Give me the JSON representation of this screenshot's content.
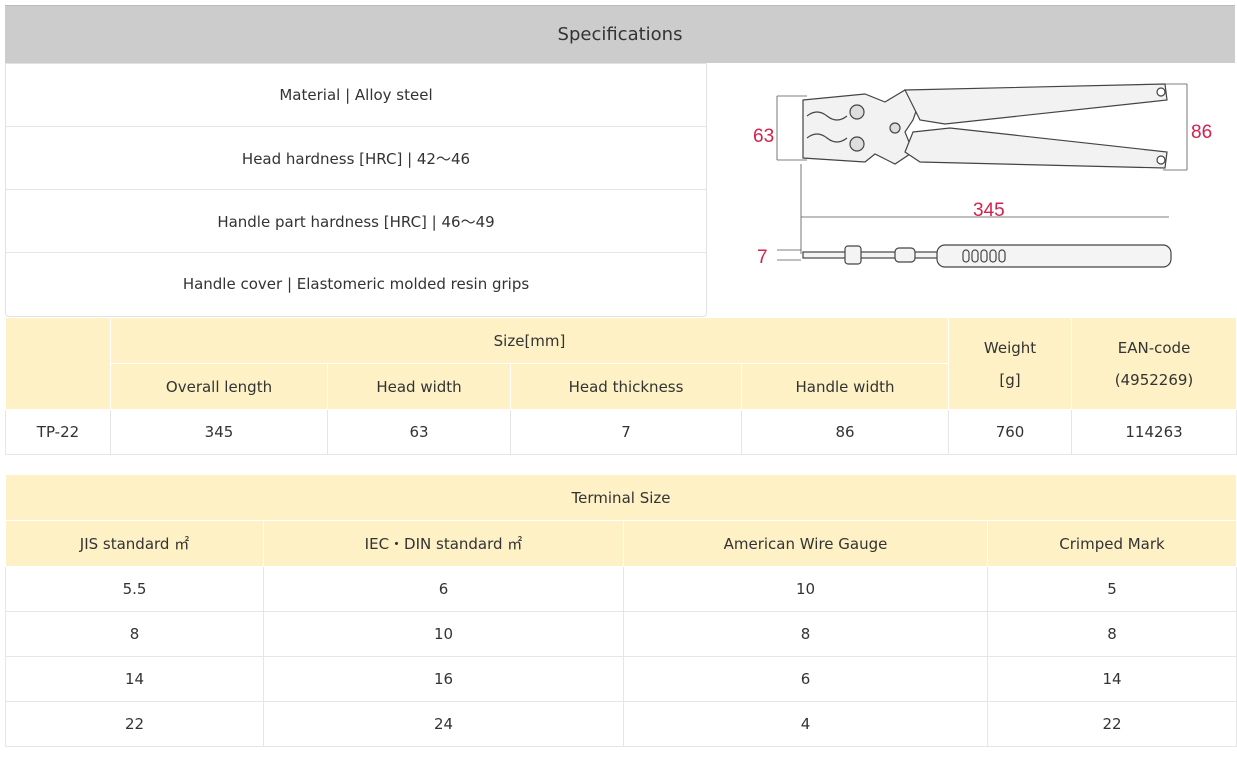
{
  "header": {
    "title": "Specifications"
  },
  "material": {
    "rows": [
      "Material | Alloy steel",
      "Head hardness [HRC] | 42〜46",
      "Handle part hardness [HRC] | 46〜49",
      "Handle cover | Elastomeric molded resin grips"
    ]
  },
  "diagram": {
    "head_width": "63",
    "handle_width": "86",
    "overall_length": "345",
    "head_thickness": "7",
    "dimension_color": "#d6204e"
  },
  "size_table": {
    "group_header": "Size[mm]",
    "weight_header": "Weight",
    "weight_unit": "[g]",
    "ean_header": "EAN-code",
    "ean_prefix": "(4952269)",
    "columns": [
      "Overall length",
      "Head width",
      "Head thickness",
      "Handle width"
    ],
    "row": {
      "model": "TP-22",
      "overall_length": "345",
      "head_width": "63",
      "head_thickness": "7",
      "handle_width": "86",
      "weight": "760",
      "ean": "114263"
    }
  },
  "terminal_table": {
    "title": "Terminal Size",
    "columns": [
      "JIS standard ㎡",
      "IEC・DIN standard ㎡",
      "American Wire Gauge",
      "Crimped Mark"
    ],
    "rows": [
      [
        "5.5",
        "6",
        "10",
        "5"
      ],
      [
        "8",
        "10",
        "8",
        "8"
      ],
      [
        "14",
        "16",
        "6",
        "14"
      ],
      [
        "22",
        "24",
        "4",
        "22"
      ]
    ]
  },
  "colors": {
    "header_bg": "#cccccc",
    "table_header_bg": "#fdf1c5"
  }
}
